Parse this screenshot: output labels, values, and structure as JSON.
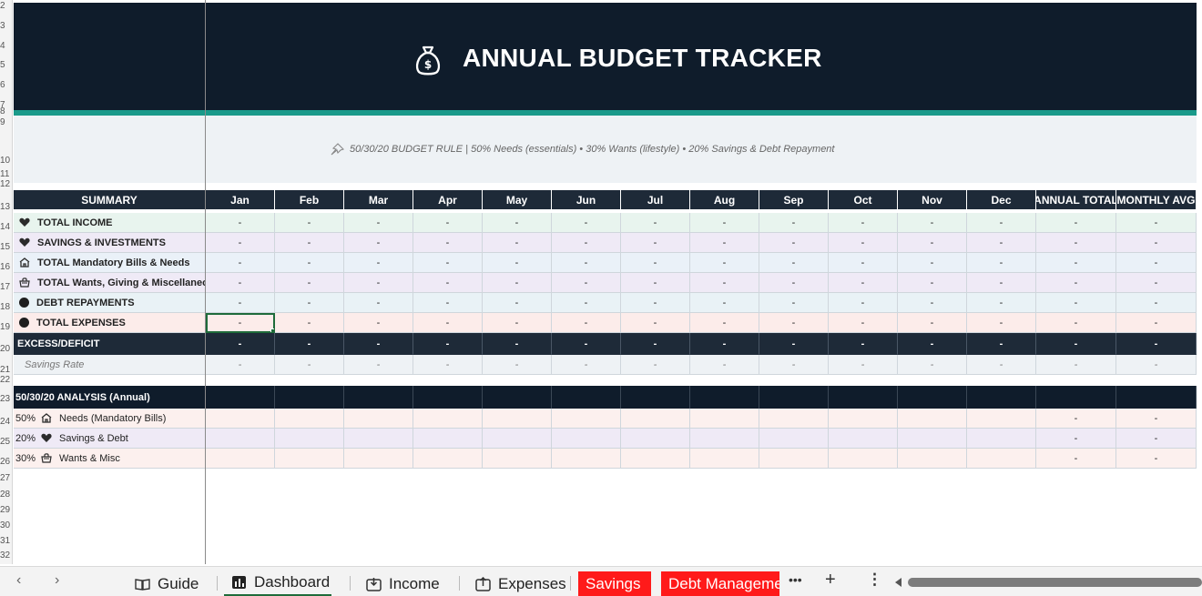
{
  "banner": {
    "title": "ANNUAL BUDGET TRACKER",
    "icon": "money-bag-icon"
  },
  "rule": {
    "text": "50/30/20 BUDGET RULE  |  50% Needs (essentials)  •  30% Wants (lifestyle)  •  20% Savings & Debt Repayment",
    "icon": "pushpin-icon"
  },
  "row_numbers": [
    "2",
    "3",
    "4",
    "5",
    "6",
    "7",
    "8",
    "9",
    "10",
    "11",
    "12",
    "13",
    "14",
    "15",
    "16",
    "17",
    "18",
    "19",
    "20",
    "21",
    "22",
    "23",
    "24",
    "25",
    "26",
    "27",
    "28",
    "29",
    "30",
    "31",
    "32"
  ],
  "summary": {
    "header_label": "SUMMARY",
    "months": [
      "Jan",
      "Feb",
      "Mar",
      "Apr",
      "May",
      "Jun",
      "Jul",
      "Aug",
      "Sep",
      "Oct",
      "Nov",
      "Dec"
    ],
    "annual_total": "ANNUAL TOTAL",
    "monthly_avg": "MONTHLY AVG",
    "rows": [
      {
        "label": "TOTAL INCOME",
        "icon": "heart-icon",
        "bg": "#e8f4ee",
        "values": [
          "-",
          "-",
          "-",
          "-",
          "-",
          "-",
          "-",
          "-",
          "-",
          "-",
          "-",
          "-",
          "-",
          "-"
        ]
      },
      {
        "label": "SAVINGS & INVESTMENTS",
        "icon": "heart-icon",
        "bg": "#efeaf6",
        "values": [
          "-",
          "-",
          "-",
          "-",
          "-",
          "-",
          "-",
          "-",
          "-",
          "-",
          "-",
          "-",
          "-",
          "-"
        ]
      },
      {
        "label": "TOTAL  Mandatory Bills & Needs",
        "icon": "house-icon",
        "bg": "#eaf1f8",
        "values": [
          "-",
          "-",
          "-",
          "-",
          "-",
          "-",
          "-",
          "-",
          "-",
          "-",
          "-",
          "-",
          "-",
          "-"
        ]
      },
      {
        "label": "TOTAL  Wants, Giving & Miscellaneous",
        "icon": "shopping-icon",
        "bg": "#efeaf6",
        "values": [
          "-",
          "-",
          "-",
          "-",
          "-",
          "-",
          "-",
          "-",
          "-",
          "-",
          "-",
          "-",
          "-",
          "-"
        ]
      },
      {
        "label": "DEBT REPAYMENTS",
        "icon": "circle-icon",
        "bg": "#e9f2f6",
        "values": [
          "-",
          "-",
          "-",
          "-",
          "-",
          "-",
          "-",
          "-",
          "-",
          "-",
          "-",
          "-",
          "-",
          "-"
        ]
      },
      {
        "label": "TOTAL EXPENSES",
        "icon": "circle-icon",
        "bg": "#fcecea",
        "values": [
          "-",
          "-",
          "-",
          "-",
          "-",
          "-",
          "-",
          "-",
          "-",
          "-",
          "-",
          "-",
          "-",
          "-"
        ]
      }
    ],
    "excess": {
      "label": "EXCESS/DEFICIT",
      "values": [
        "-",
        "-",
        "-",
        "-",
        "-",
        "-",
        "-",
        "-",
        "-",
        "-",
        "-",
        "-",
        "-",
        "-"
      ]
    },
    "savings_rate": {
      "label": "Savings Rate",
      "values": [
        "-",
        "-",
        "-",
        "-",
        "-",
        "-",
        "-",
        "-",
        "-",
        "-",
        "-",
        "-",
        "-",
        "-"
      ]
    }
  },
  "analysis": {
    "header_label": "50/30/20 ANALYSIS (Annual)",
    "rows": [
      {
        "pct": "50%",
        "label": "Needs (Mandatory Bills)",
        "icon": "house-icon",
        "bg": "#fcf0ee",
        "total": "-",
        "avg": "-"
      },
      {
        "pct": "20%",
        "label": "Savings & Debt",
        "icon": "heart-icon",
        "bg": "#efeaf6",
        "total": "-",
        "avg": "-"
      },
      {
        "pct": "30%",
        "label": "Wants & Misc",
        "icon": "shopping-icon",
        "bg": "#fcf0ee",
        "total": "-",
        "avg": "-"
      }
    ]
  },
  "tabs": {
    "items": [
      {
        "label": "Guide",
        "icon": "book-icon"
      },
      {
        "label": "Dashboard",
        "icon": "chart-icon",
        "active": true
      },
      {
        "label": "Income",
        "icon": "inbox-icon"
      },
      {
        "label": "Expenses",
        "icon": "outbox-icon"
      },
      {
        "label": "Savings",
        "red": true
      },
      {
        "label": "Debt Management",
        "red": true
      }
    ],
    "more": "•••",
    "add": "+",
    "menu": "⋮"
  }
}
